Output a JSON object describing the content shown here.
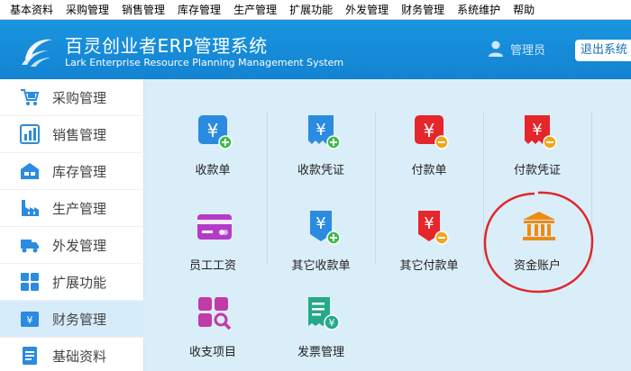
{
  "menubar": [
    "基本资料",
    "采购管理",
    "销售管理",
    "库存管理",
    "生产管理",
    "扩展功能",
    "外发管理",
    "财务管理",
    "系统维护",
    "帮助"
  ],
  "header": {
    "title_cn": "百灵创业者ERP管理系统",
    "title_en": "Lark Enterprise Resource Planning Management System",
    "user": "管理员",
    "logout": "退出系统"
  },
  "sidebar": {
    "items": [
      {
        "label": "采购管理",
        "icon": "cart-icon"
      },
      {
        "label": "销售管理",
        "icon": "bar-chart-icon"
      },
      {
        "label": "库存管理",
        "icon": "boxes-icon"
      },
      {
        "label": "生产管理",
        "icon": "factory-icon"
      },
      {
        "label": "外发管理",
        "icon": "truck-icon"
      },
      {
        "label": "扩展功能",
        "icon": "grid-icon"
      },
      {
        "label": "财务管理",
        "icon": "yuan-box-icon",
        "active": true
      },
      {
        "label": "基础资料",
        "icon": "document-icon"
      }
    ]
  },
  "tiles": [
    {
      "label": "收款单",
      "icon": "receipt-plus-icon"
    },
    {
      "label": "收款凭证",
      "icon": "voucher-plus-icon"
    },
    {
      "label": "付款单",
      "icon": "payment-minus-icon"
    },
    {
      "label": "付款凭证",
      "icon": "voucher-minus-icon"
    },
    {
      "label": "员工工资",
      "icon": "salary-card-icon"
    },
    {
      "label": "其它收款单",
      "icon": "other-receipt-icon"
    },
    {
      "label": "其它付款单",
      "icon": "other-payment-icon"
    },
    {
      "label": "资金账户",
      "icon": "bank-icon"
    },
    {
      "label": "收支项目",
      "icon": "category-search-icon"
    },
    {
      "label": "发票管理",
      "icon": "invoice-icon"
    }
  ],
  "colors": {
    "header": "#1a8fdc",
    "content_bg": "#daeef9",
    "annotation": "#e0262b"
  }
}
